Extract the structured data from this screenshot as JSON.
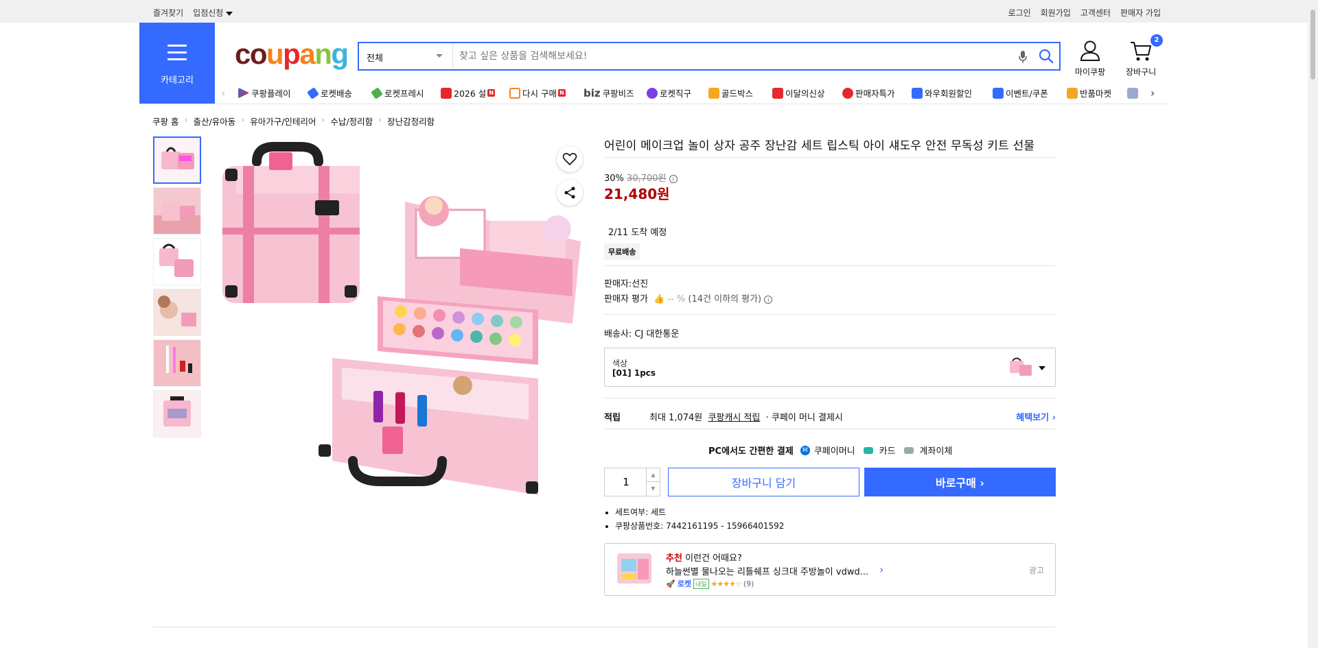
{
  "topbar": {
    "left": [
      "즐겨찾기",
      "입점신청"
    ],
    "right": [
      "로그인",
      "회원가입",
      "고객센터",
      "판매자 가입"
    ]
  },
  "category_button": "카테고리",
  "logo": {
    "text": "coupang"
  },
  "search": {
    "category": "전체",
    "placeholder": "찾고 싶은 상품을 검색해보세요!"
  },
  "header": {
    "mycoupang": "마이쿠팡",
    "cart": "장바구니",
    "cart_count": "2"
  },
  "shortcuts": [
    {
      "label": "쿠팡플레이",
      "color": "#2f6bf0",
      "new": false
    },
    {
      "label": "로켓배송",
      "color": "#346aff",
      "new": false
    },
    {
      "label": "로켓프레시",
      "color": "#4cb050",
      "new": false
    },
    {
      "label": "2026 설",
      "color": "#e4282d",
      "new": true
    },
    {
      "label": "다시 구매",
      "color": "#f58220",
      "new": true
    },
    {
      "label": "쿠팡비즈",
      "prefix": "biz",
      "color": "#555",
      "new": false
    },
    {
      "label": "로켓직구",
      "color": "#7b3fe4",
      "new": false
    },
    {
      "label": "골드박스",
      "color": "#f5a623",
      "new": false
    },
    {
      "label": "이달의신상",
      "color": "#e4282d",
      "new": false
    },
    {
      "label": "판매자특가",
      "color": "#e4282d",
      "new": false
    },
    {
      "label": "와우회원할인",
      "color": "#346aff",
      "new": false
    },
    {
      "label": "이벤트/쿠폰",
      "color": "#346aff",
      "new": false
    },
    {
      "label": "반품마켓",
      "color": "#f5a623",
      "new": false
    }
  ],
  "breadcrumb": [
    "쿠팡 홈",
    "출산/유아동",
    "유아가구/인테리어",
    "수납/정리함",
    "장난감정리함"
  ],
  "product": {
    "title": "어린이 메이크업 놀이 상자 공주 장난감 세트 립스틱 아이 섀도우 안전 무독성 키트 선물",
    "discount": "30%",
    "original_price": "30,700원",
    "price": "21,480원",
    "arrival": "2/11 도착 예정",
    "free_shipping": "무료배송",
    "seller_label": "판매자:",
    "seller": "선진",
    "rating_label": "판매자 평가",
    "rating_value": "-- %",
    "rating_note": "(14건 이하의 평가)",
    "shipper_label": "배송사:",
    "shipper": "CJ 대한통운",
    "option_label": "색상",
    "option_value": "[01] 1pcs",
    "reward_label": "적립",
    "reward_text_1": "최대 1,074원",
    "reward_link": "쿠팡캐시 적립",
    "reward_text_2": "· 쿠페이 머니 결제시",
    "reward_more": "혜택보기",
    "pay_title": "PC에서도 간편한 결제",
    "pay_methods": [
      "쿠페이머니",
      "카드",
      "계좌이체"
    ],
    "quantity": "1",
    "cart_button": "장바구니 담기",
    "buy_button": "바로구매",
    "specs": [
      "세트여부: 세트",
      "쿠팡상품번호: 7442161195 - 15966401592"
    ]
  },
  "recommend": {
    "head_red": "추천",
    "head_rest": "이런건 어때요?",
    "title": "하늘썬별 물나오는 리틀쉐프 싱크대 주방놀이 vdwd...",
    "rocket": "로켓",
    "tomorrow": "내일",
    "stars": "★★★★☆",
    "reviews": "(9)",
    "ad_label": "광고"
  }
}
